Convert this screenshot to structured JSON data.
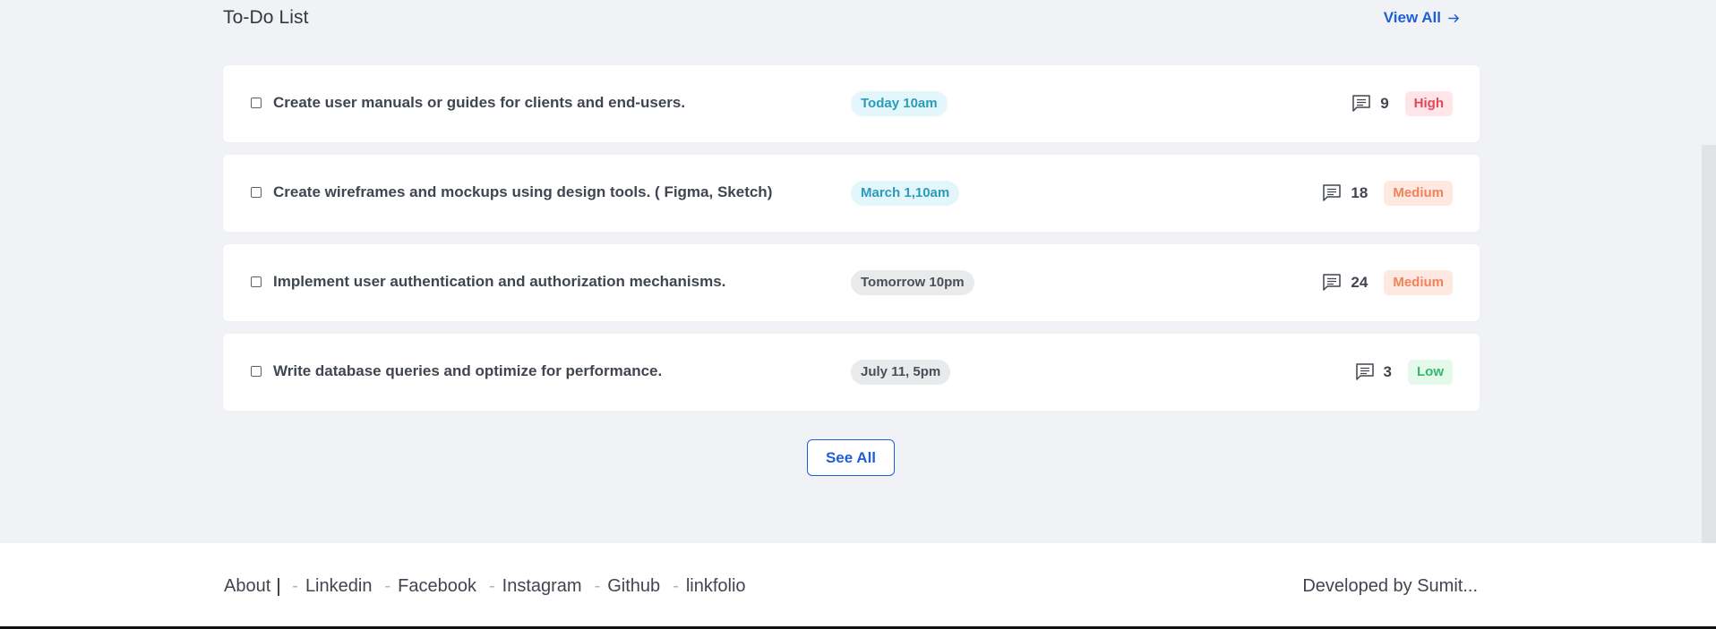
{
  "section": {
    "title": "To-Do List",
    "view_all_label": "View All"
  },
  "tasks": [
    {
      "title": "Create user manuals or guides for clients and end-users.",
      "date": "Today 10am",
      "date_style": "cyan",
      "comments": "9",
      "priority": "High",
      "priority_style": "high"
    },
    {
      "title": "Create wireframes and mockups using design tools. ( Figma, Sketch)",
      "date": "March 1,10am",
      "date_style": "cyan",
      "comments": "18",
      "priority": "Medium",
      "priority_style": "medium"
    },
    {
      "title": "Implement user authentication and authorization mechanisms.",
      "date": "Tomorrow 10pm",
      "date_style": "gray",
      "comments": "24",
      "priority": "Medium",
      "priority_style": "medium"
    },
    {
      "title": "Write database queries and optimize for performance.",
      "date": "July 11, 5pm",
      "date_style": "gray",
      "comments": "3",
      "priority": "Low",
      "priority_style": "low"
    }
  ],
  "see_all_label": "See All",
  "footer": {
    "about": "About",
    "links": [
      "Linkedin",
      "Facebook",
      "Instagram",
      "Github",
      "linkfolio"
    ],
    "separator": "-",
    "credit": "Developed by Sumit..."
  },
  "colors": {
    "accent": "#1f5fd6",
    "background": "#f1f2f6",
    "priority_high": "#e24759",
    "priority_medium": "#f08358",
    "priority_low": "#35b866",
    "date_cyan": "#2b9bb8"
  },
  "icons": {
    "view_all": "arrow-right-icon",
    "comments": "comment-icon"
  }
}
